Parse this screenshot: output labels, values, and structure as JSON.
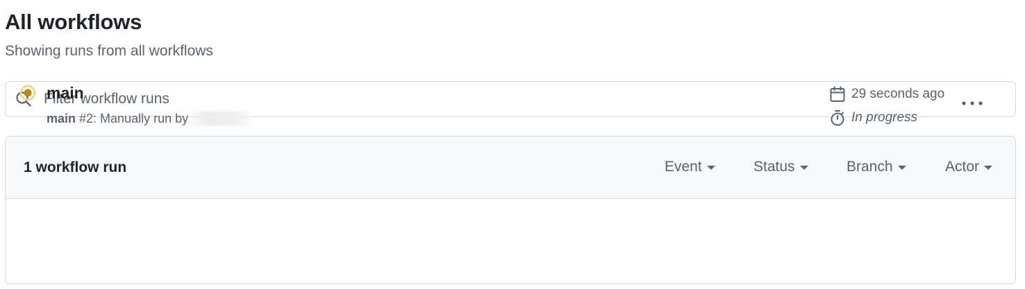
{
  "header": {
    "title": "All workflows",
    "subtitle": "Showing runs from all workflows"
  },
  "search": {
    "placeholder": "Filter workflow runs",
    "value": ""
  },
  "runs_box": {
    "count_label": "1 workflow run",
    "filters": [
      {
        "label": "Event"
      },
      {
        "label": "Status"
      },
      {
        "label": "Branch"
      },
      {
        "label": "Actor"
      }
    ],
    "runs": [
      {
        "name": "main",
        "branch": "main",
        "description": "#2: Manually run by",
        "status": "in_progress",
        "status_color": "#bf8700",
        "time": "29 seconds ago",
        "state_label": "In progress"
      }
    ]
  },
  "icons": {
    "search": "search-icon",
    "calendar": "calendar-icon",
    "stopwatch": "stopwatch-icon",
    "status": "in-progress-dot-icon",
    "kebab": "kebab-horizontal-icon"
  }
}
